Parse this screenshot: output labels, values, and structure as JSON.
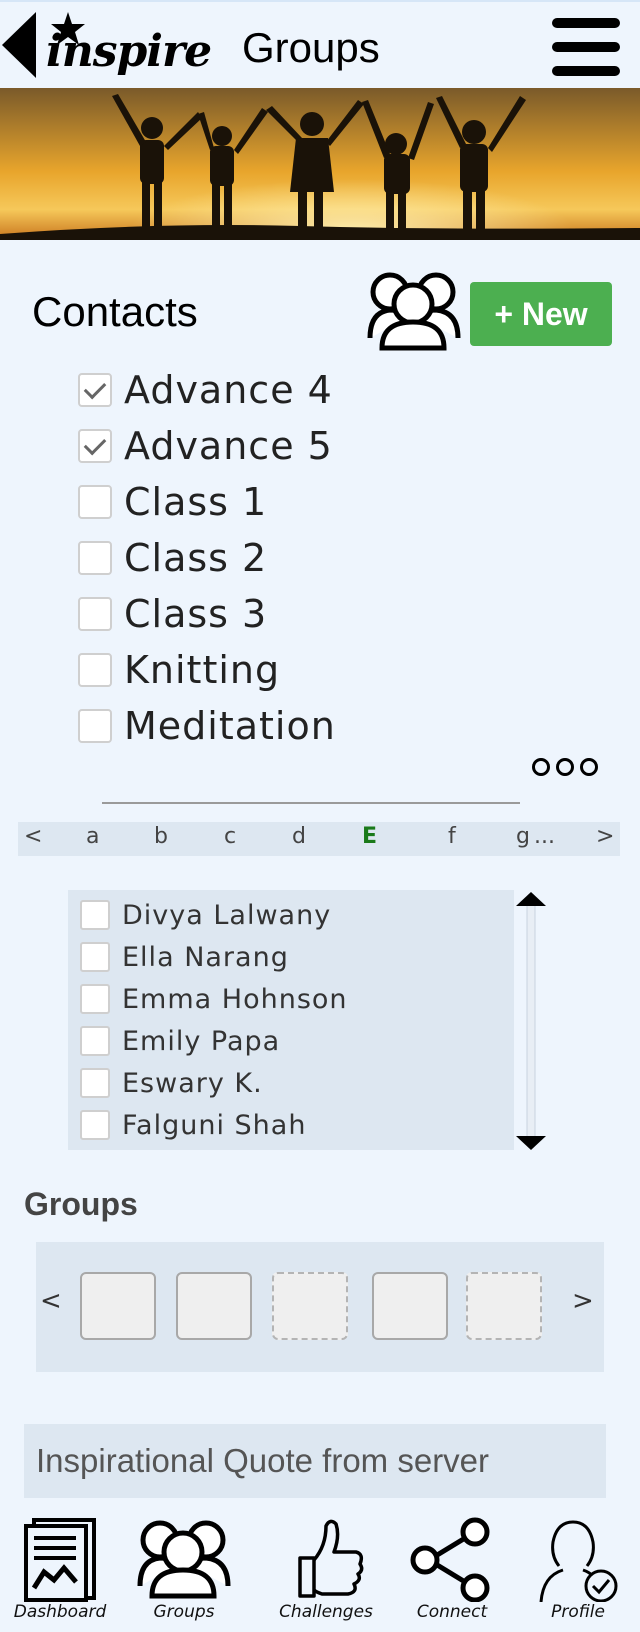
{
  "header": {
    "logo_text": "inspire",
    "title": "Groups"
  },
  "contacts": {
    "title": "Contacts",
    "new_button": "+ New",
    "groups": [
      {
        "label": "Advance 4",
        "checked": true
      },
      {
        "label": "Advance 5",
        "checked": true
      },
      {
        "label": "Class 1",
        "checked": false
      },
      {
        "label": "Class 2",
        "checked": false
      },
      {
        "label": "Class 3",
        "checked": false
      },
      {
        "label": "Knitting",
        "checked": false
      },
      {
        "label": "Meditation",
        "checked": false
      }
    ]
  },
  "alphabet": {
    "prev": "<",
    "letters": [
      "a",
      "b",
      "c",
      "d",
      "E",
      "f",
      "g"
    ],
    "active": "E",
    "ellipsis": "...",
    "next": ">"
  },
  "contact_list": [
    "Divya Lalwany",
    "Ella Narang",
    "Emma Hohnson",
    "Emily Papa",
    "Eswary K.",
    "Falguni Shah"
  ],
  "groups_section": {
    "title": "Groups",
    "prev": "<",
    "next": ">",
    "slots": [
      "solid",
      "solid",
      "dashed",
      "solid",
      "dashed"
    ]
  },
  "quote": "Inspirational Quote from server",
  "nav": {
    "dashboard": "Dashboard",
    "groups": "Groups",
    "challenges": "Challenges",
    "connect": "Connect",
    "profile": "Profile"
  },
  "colors": {
    "background": "#eef5fd",
    "panel": "#dde7f1",
    "new_button": "#4caf50",
    "active_letter": "#1a7a1a"
  },
  "icons": {
    "back": "back-arrow-icon",
    "menu": "hamburger-icon",
    "groups": "people-group-icon",
    "more": "more-dots-icon",
    "scroll": "scrollbar-arrows-icon",
    "dashboard": "document-chart-icon",
    "challenges": "thumbs-up-icon",
    "connect": "share-nodes-icon",
    "profile": "user-check-icon"
  }
}
